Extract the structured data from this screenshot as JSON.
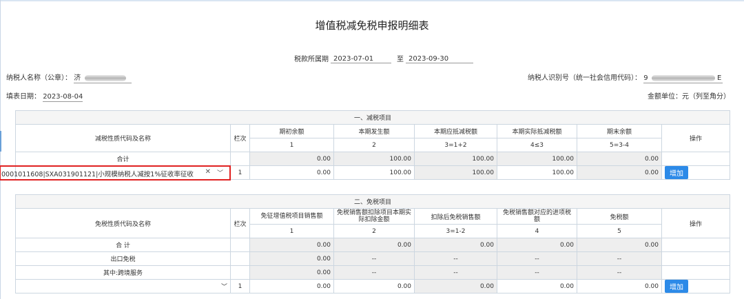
{
  "title": "增值税减免税申报明细表",
  "period": {
    "label": "税款所属期",
    "start": "2023-07-01",
    "sep": "至",
    "end": "2023-09-30"
  },
  "taxpayer": {
    "name_label": "纳税人名称（公章）：",
    "name_value": "济",
    "id_label": "纳税人识别号（统一社会信用代码）：",
    "id_prefix": "9",
    "id_suffix": "E"
  },
  "fill_date": {
    "label": "填表日期：",
    "value": "2023-08-04"
  },
  "unit": "金额单位：元（列至角分）",
  "section1": {
    "title": "一、减税项目",
    "col_name": "减税性质代码及名称",
    "col_line": "栏次",
    "headers": [
      "期初余额",
      "本期发生额",
      "本期应抵减税额",
      "本期实际抵减税额",
      "期末余额"
    ],
    "formulas": [
      "1",
      "2",
      "3=1+2",
      "4≤3",
      "5=3-4"
    ],
    "col_action": "操作",
    "total": {
      "label": "合计",
      "values": [
        "0.00",
        "100.00",
        "100.00",
        "100.00",
        "0.00"
      ]
    },
    "row": {
      "select": "0001011608|SXA031901121|小规模纳税人减按1%征收率征收",
      "line": "1",
      "values": [
        "0.00",
        "100.00",
        "100.00",
        "100.00",
        "0.00"
      ],
      "button": "增加"
    }
  },
  "section2": {
    "title": "二、免税项目",
    "col_name": "免税性质代码及名称",
    "col_line": "栏次",
    "headers": [
      "免征增值税项目销售额",
      "免税销售额扣除项目本期实际扣除金额",
      "扣除后免税销售额",
      "免税销售额对应的进项税额",
      "免税额"
    ],
    "formulas": [
      "1",
      "2",
      "3=1-2",
      "4",
      "5"
    ],
    "col_action": "操作",
    "total": {
      "label": "合 计",
      "values": [
        "0.00",
        "0.00",
        "0.00",
        "0.00",
        "0.00"
      ]
    },
    "export": {
      "label": "出口免税",
      "values": [
        "0.00",
        "--",
        "--",
        "--",
        "--"
      ]
    },
    "cross": {
      "label": "其中:跨境服务",
      "values": [
        "0.00",
        "--",
        "--",
        "--",
        "--"
      ]
    },
    "row": {
      "line": "1",
      "values": [
        "0.00",
        "0.00",
        "0.00",
        "0.00",
        "0.00"
      ],
      "button": "增加"
    }
  }
}
